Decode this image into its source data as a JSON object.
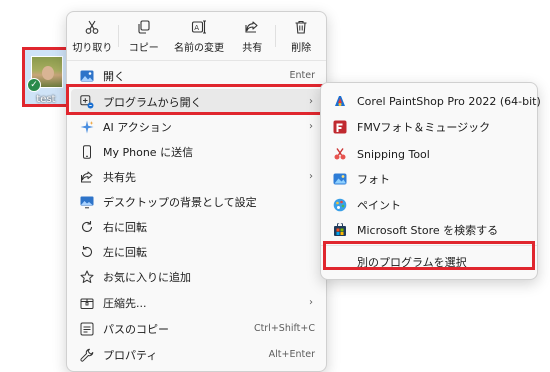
{
  "desktop_item": {
    "label": "test"
  },
  "toolbar": [
    {
      "label": "切り取り",
      "icon": "cut-icon"
    },
    {
      "label": "コピー",
      "icon": "copy-icon"
    },
    {
      "label": "名前の変更",
      "icon": "rename-icon"
    },
    {
      "label": "共有",
      "icon": "share-icon"
    },
    {
      "label": "削除",
      "icon": "delete-icon"
    }
  ],
  "menu": [
    {
      "label": "開く",
      "shortcut": "Enter",
      "icon": "image-icon"
    },
    {
      "label": "プログラムから開く",
      "submenu": true,
      "icon": "open-with-icon"
    },
    {
      "label": "AI アクション",
      "submenu": true,
      "icon": "sparkle-icon"
    },
    {
      "label": "My Phone に送信",
      "icon": "phone-icon"
    },
    {
      "label": "共有先",
      "submenu": true,
      "icon": "share-icon"
    },
    {
      "label": "デスクトップの背景として設定",
      "icon": "desktop-background-icon"
    },
    {
      "label": "右に回転",
      "icon": "rotate-right-icon"
    },
    {
      "label": "左に回転",
      "icon": "rotate-left-icon"
    },
    {
      "label": "お気に入りに追加",
      "icon": "star-icon"
    },
    {
      "label": "圧縮先...",
      "submenu": true,
      "icon": "zip-icon"
    },
    {
      "label": "パスのコピー",
      "shortcut": "Ctrl+Shift+C",
      "icon": "copy-path-icon"
    },
    {
      "label": "プロパティ",
      "shortcut": "Alt+Enter",
      "icon": "wrench-icon"
    }
  ],
  "submenu": [
    {
      "label": "Corel PaintShop Pro 2022 (64-bit)",
      "icon": "paintshop-icon"
    },
    {
      "label": "FMVフォト＆ミュージック",
      "icon": "fmv-icon"
    },
    {
      "label": "Snipping Tool",
      "icon": "snipping-tool-icon"
    },
    {
      "label": "フォト",
      "icon": "photos-icon"
    },
    {
      "label": "ペイント",
      "icon": "paint-icon"
    },
    {
      "label": "Microsoft Store を検索する",
      "icon": "store-icon"
    },
    {
      "label": "別のプログラムを選択",
      "icon": ""
    }
  ],
  "colors": {
    "highlight_border": "#e0262e",
    "menu_bg": "#f9f9f9",
    "accent_blue": "#1a6fd1"
  }
}
